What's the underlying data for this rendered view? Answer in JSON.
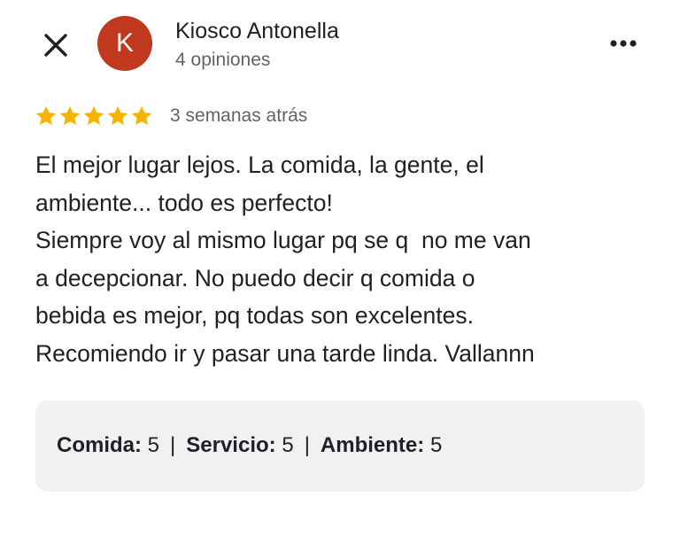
{
  "header": {
    "close_icon": "close-icon",
    "avatar_letter": "K",
    "avatar_color": "#c0391f",
    "author_name": "Kiosco Antonella",
    "author_meta": "4 opiniones",
    "more_icon": "more-horizontal-icon"
  },
  "review": {
    "rating": 5,
    "rating_max": 5,
    "star_color": "#f5b400",
    "date": "3 semanas atrás",
    "text_lines": [
      "El mejor lugar lejos. La comida, la gente, el",
      "ambiente... todo es perfecto!",
      "Siempre voy al mismo lugar pq se q  no me van",
      "a decepcionar. No puedo decir q comida o",
      "bebida es mejor, pq todas son excelentes.",
      "Recomiendo ir y pasar una tarde linda. Vallannn"
    ]
  },
  "sub_ratings": {
    "items": [
      {
        "label": "Comida:",
        "value": "5"
      },
      {
        "label": "Servicio:",
        "value": "5"
      },
      {
        "label": "Ambiente:",
        "value": "5"
      }
    ],
    "separator": "|"
  }
}
